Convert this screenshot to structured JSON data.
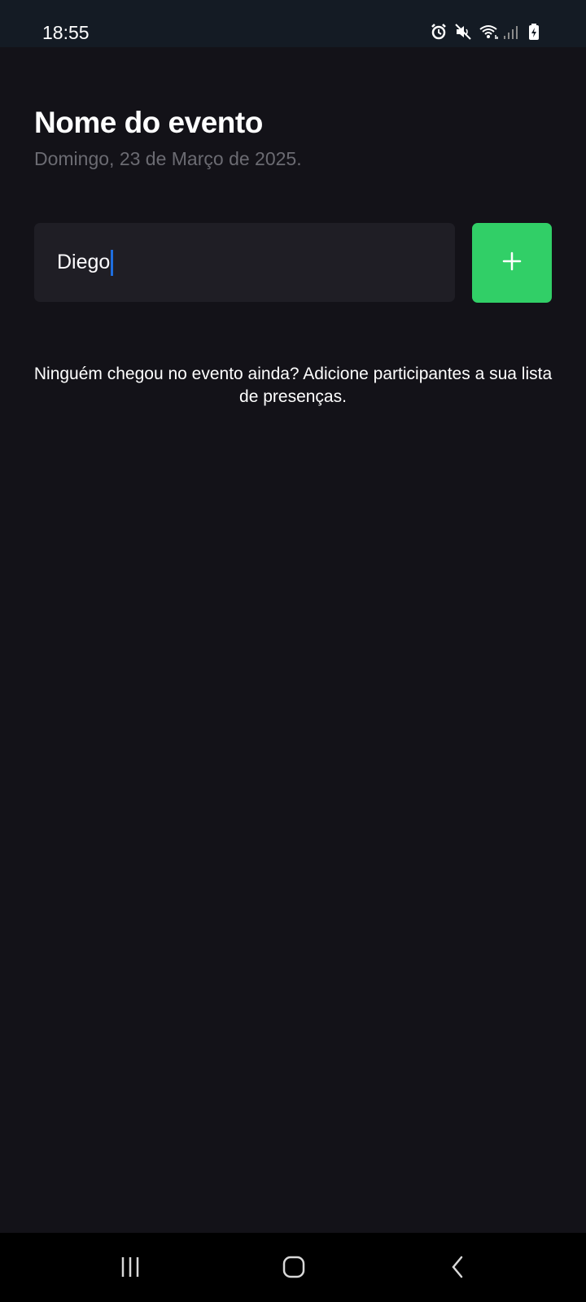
{
  "status_bar": {
    "time": "18:55",
    "icons": [
      "alarm-icon",
      "mute-icon",
      "wifi-icon",
      "signal-icon",
      "battery-icon"
    ]
  },
  "event": {
    "title": "Nome do evento",
    "date": "Domingo, 23 de Março de 2025."
  },
  "participant_input": {
    "value": "Diego"
  },
  "add_button": {
    "label": "+",
    "color": "#31cf67"
  },
  "empty_state": {
    "message": "Ninguém chegou no evento ainda? Adicione participantes a sua lista de presenças."
  },
  "nav": {
    "items": [
      "recent-apps-icon",
      "home-icon",
      "back-icon"
    ]
  }
}
